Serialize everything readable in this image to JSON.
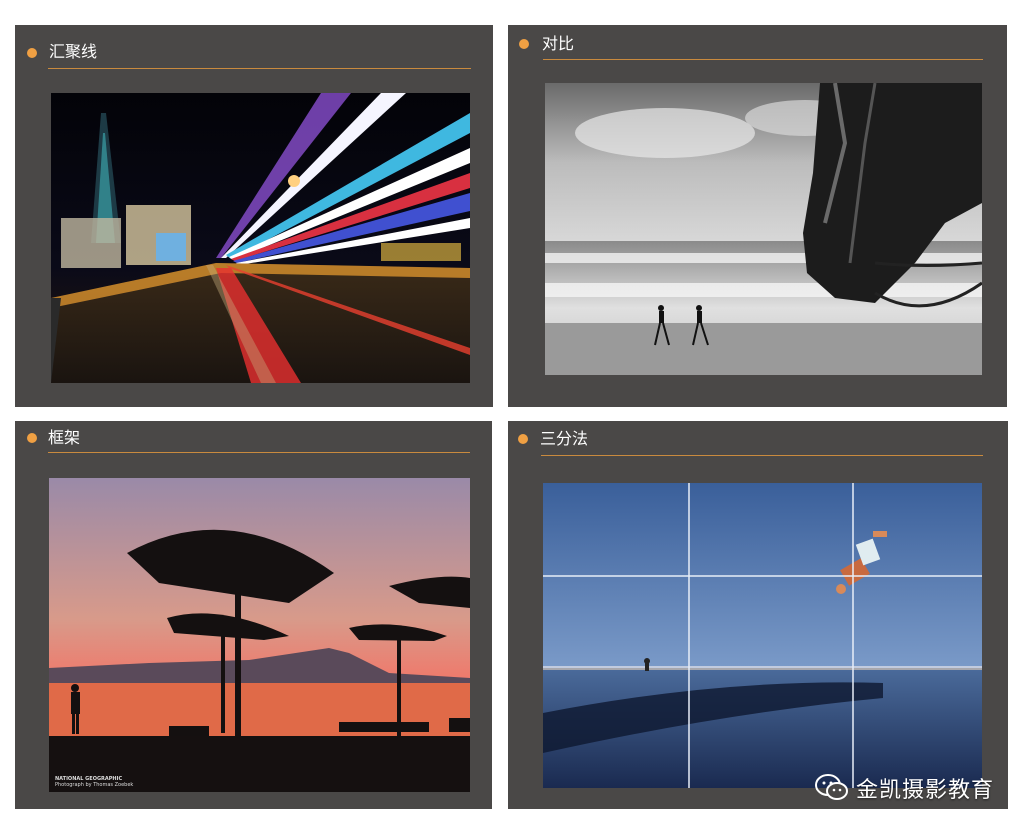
{
  "panels": [
    {
      "title": "汇聚线",
      "photo": "light-trails-city-night"
    },
    {
      "title": "对比",
      "photo": "horse-beach-children"
    },
    {
      "title": "框架",
      "photo": "beach-umbrellas-sunset"
    },
    {
      "title": "三分法",
      "photo": "rule-of-thirds-flip-beach"
    }
  ],
  "framing_photo": {
    "badge_text": "NATIONAL GEOGRAPHIC",
    "credit": "Photograph by Thomas Zoebek"
  },
  "watermark": {
    "text": "金凯摄影教育",
    "icon": "wechat-icon"
  },
  "colors": {
    "panel_bg": "#4a4847",
    "accent_dot": "#f0a043",
    "rule": "#c98a3e"
  }
}
